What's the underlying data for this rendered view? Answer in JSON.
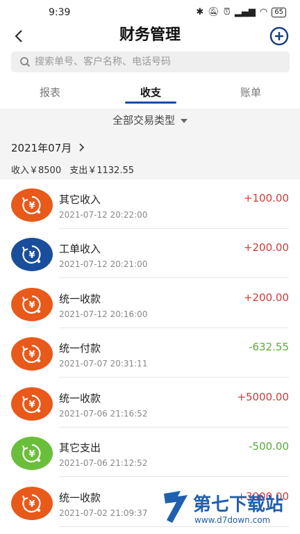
{
  "status_bar": {
    "time": "9:39",
    "battery": "65"
  },
  "header": {
    "title": "财务管理"
  },
  "search": {
    "placeholder": "搜索单号、客户名称、电话号码"
  },
  "tabs": [
    {
      "label": "报表",
      "active": false
    },
    {
      "label": "收支",
      "active": true
    },
    {
      "label": "账单",
      "active": false
    }
  ],
  "filter": {
    "label": "全部交易类型"
  },
  "month": {
    "label": "2021年07月"
  },
  "summary": {
    "income": "收入￥8500",
    "expense": "支出￥1132.55"
  },
  "transactions": [
    {
      "name": "其它收入",
      "time": "2021-07-12 20:22:00",
      "amount": "+100.00",
      "type": "income",
      "icon_color": "#e8591a"
    },
    {
      "name": "工单收入",
      "time": "2021-07-12 20:21:00",
      "amount": "+200.00",
      "type": "income",
      "icon_color": "#1a4d9c"
    },
    {
      "name": "统一收款",
      "time": "2021-07-12 20:16:00",
      "amount": "+200.00",
      "type": "income",
      "icon_color": "#e8591a"
    },
    {
      "name": "统一付款",
      "time": "2021-07-07 20:31:11",
      "amount": "-632.55",
      "type": "expense",
      "icon_color": "#e8591a"
    },
    {
      "name": "统一收款",
      "time": "2021-07-06 21:16:52",
      "amount": "+5000.00",
      "type": "income",
      "icon_color": "#e8591a"
    },
    {
      "name": "其它支出",
      "time": "2021-07-06 21:12:52",
      "amount": "-500.00",
      "type": "expense",
      "icon_color": "#6abf3a"
    },
    {
      "name": "统一收款",
      "time": "2021-07-02 21:09:37",
      "amount": "+3000.00",
      "type": "income",
      "icon_color": "#e8591a"
    }
  ],
  "colors": {
    "income": "#d23a3a",
    "expense": "#5aaa3a",
    "accent": "#1a4d9c"
  },
  "watermark": {
    "brand": "第七下载站",
    "url": "www.d7down.com"
  }
}
